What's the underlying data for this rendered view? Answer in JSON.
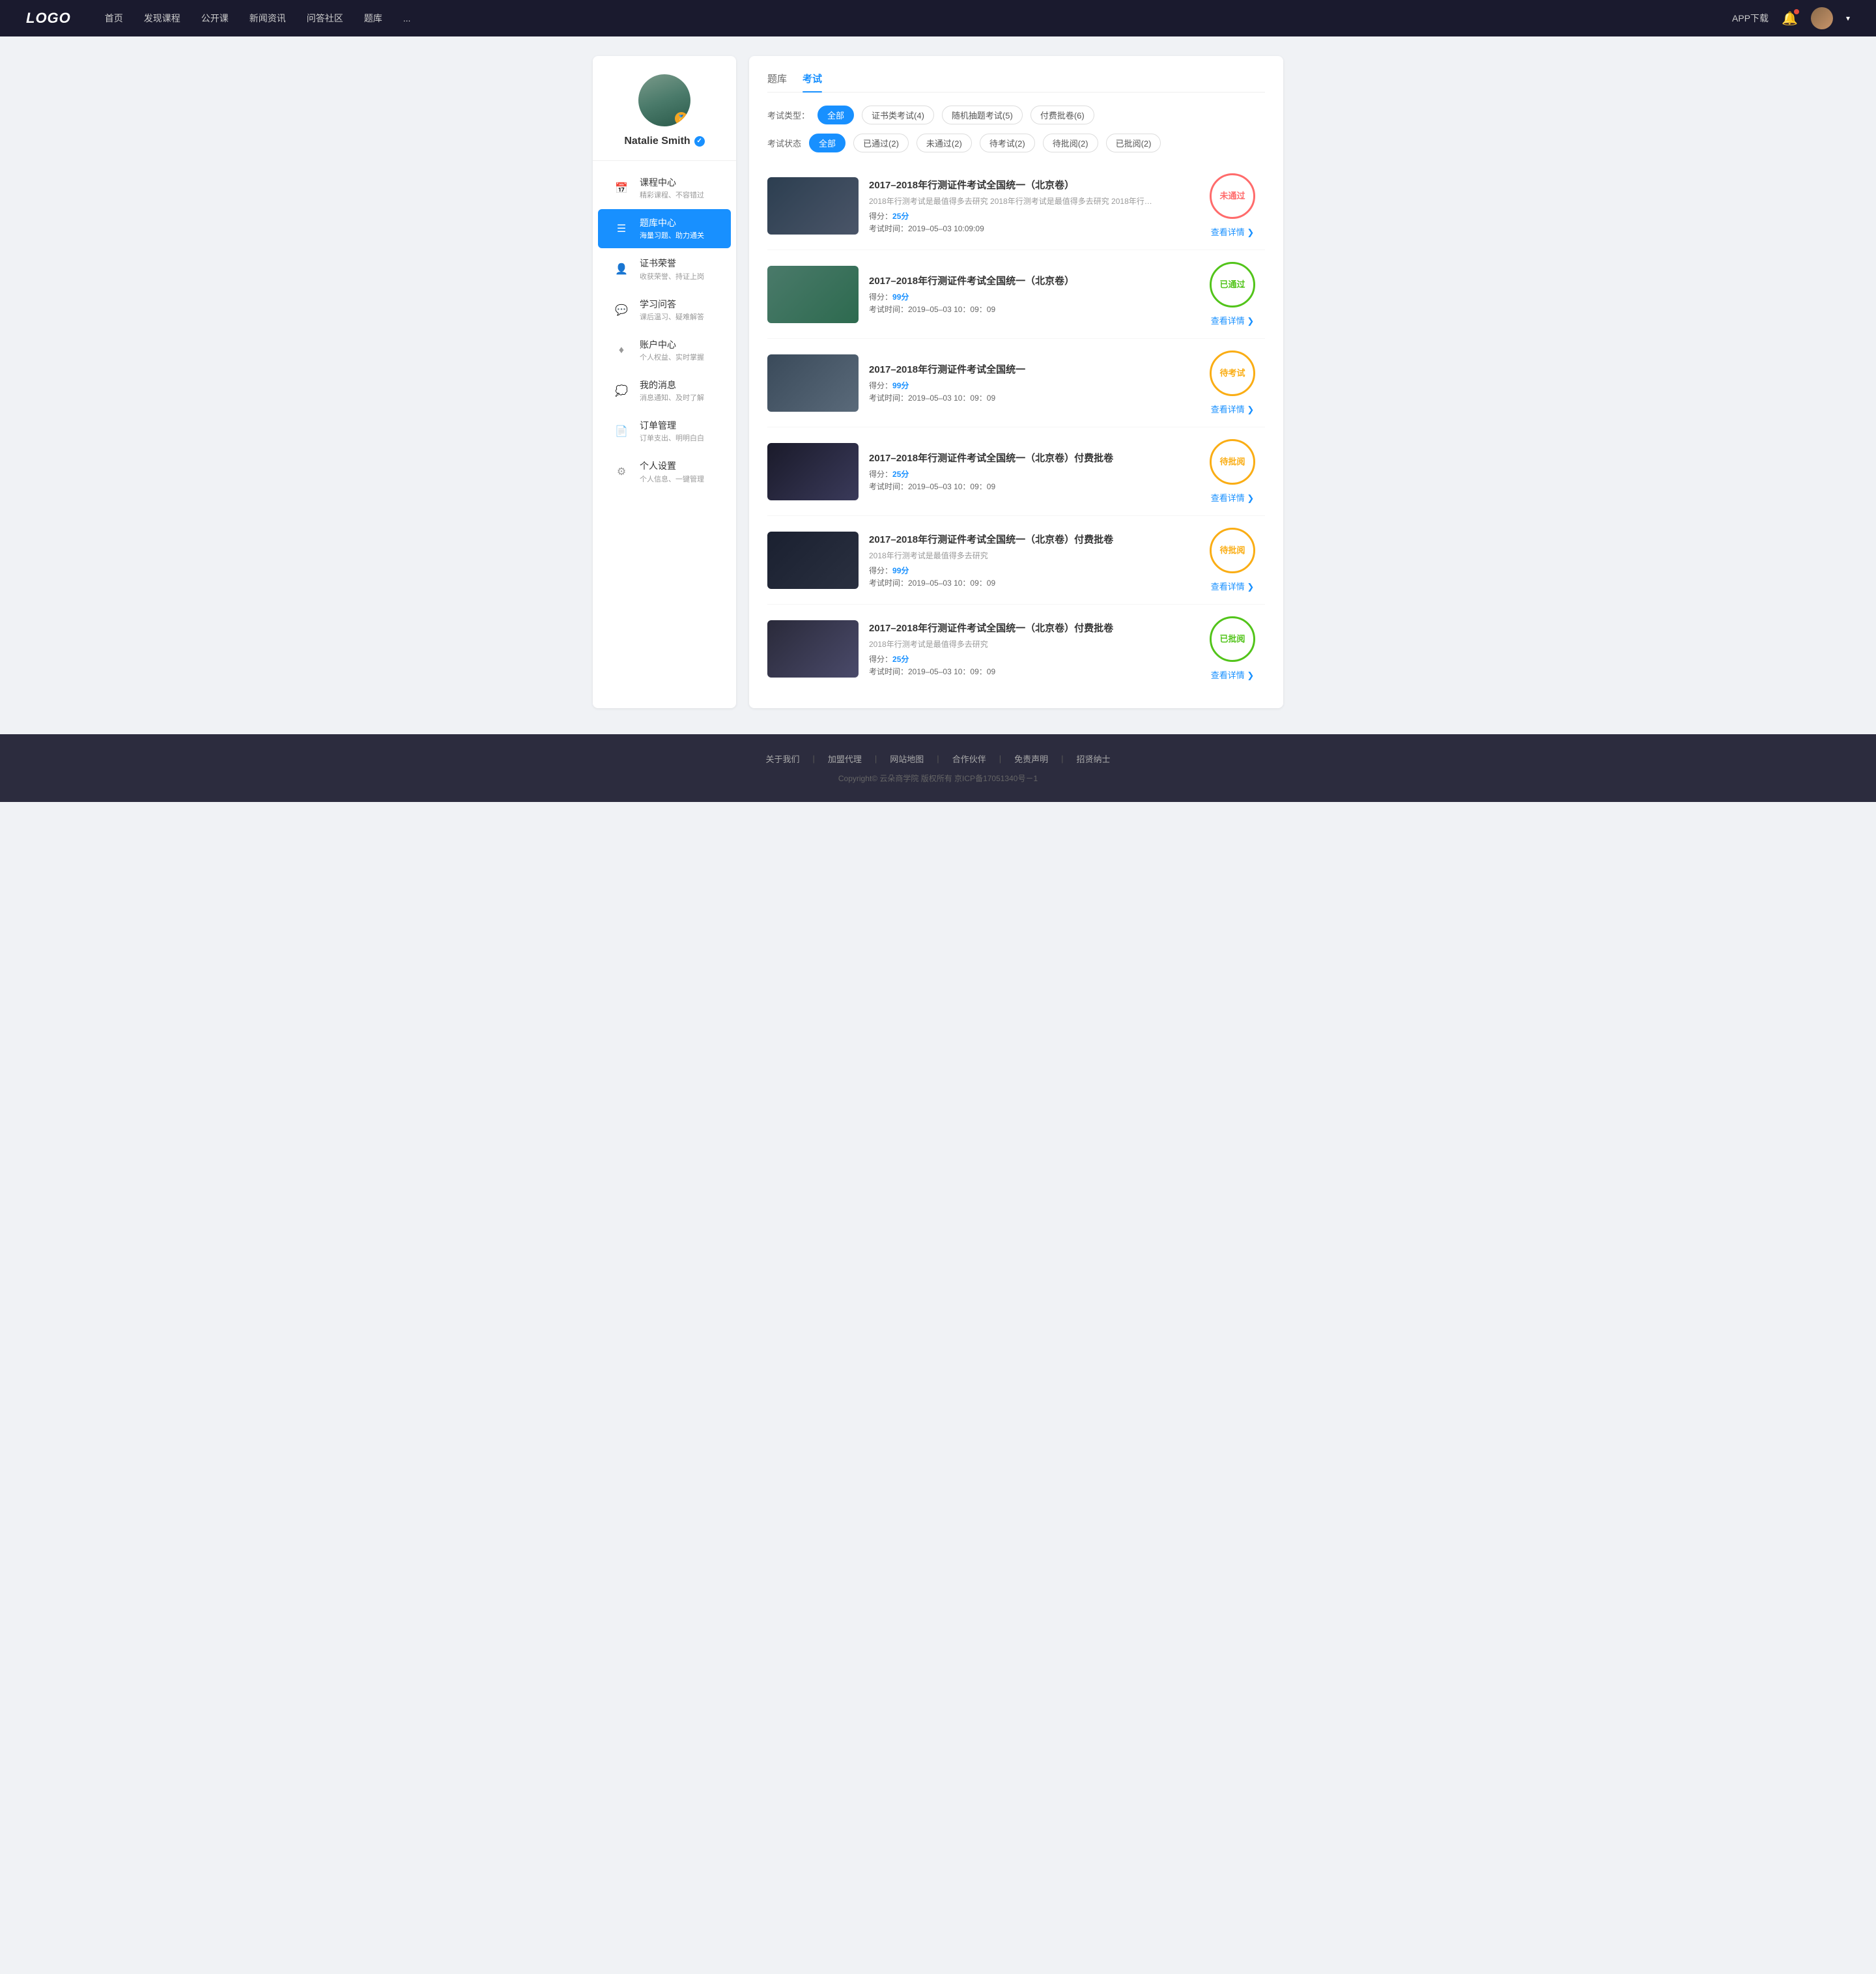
{
  "navbar": {
    "logo": "LOGO",
    "links": [
      "首页",
      "发现课程",
      "公开课",
      "新闻资讯",
      "问答社区",
      "题库",
      "..."
    ],
    "app_download": "APP下载",
    "user_menu_arrow": "▾"
  },
  "sidebar": {
    "username": "Natalie Smith",
    "verified_icon": "✓",
    "menu": [
      {
        "id": "course",
        "icon": "📅",
        "title": "课程中心",
        "subtitle": "精彩课程、不容错过"
      },
      {
        "id": "question-bank",
        "icon": "☰",
        "title": "题库中心",
        "subtitle": "海量习题、助力通关",
        "active": true
      },
      {
        "id": "certificate",
        "icon": "👤",
        "title": "证书荣誉",
        "subtitle": "收获荣誉、持证上岗"
      },
      {
        "id": "qa",
        "icon": "💬",
        "title": "学习问答",
        "subtitle": "课后温习、疑难解答"
      },
      {
        "id": "account",
        "icon": "♦",
        "title": "账户中心",
        "subtitle": "个人权益、实时掌握"
      },
      {
        "id": "messages",
        "icon": "💭",
        "title": "我的消息",
        "subtitle": "消息通知、及时了解"
      },
      {
        "id": "orders",
        "icon": "📄",
        "title": "订单管理",
        "subtitle": "订单支出、明明白白"
      },
      {
        "id": "settings",
        "icon": "⚙",
        "title": "个人设置",
        "subtitle": "个人信息、一键管理"
      }
    ]
  },
  "content": {
    "tabs": [
      {
        "id": "question-bank",
        "label": "题库"
      },
      {
        "id": "exam",
        "label": "考试",
        "active": true
      }
    ],
    "filter_type": {
      "label": "考试类型：",
      "options": [
        {
          "label": "全部",
          "active": true
        },
        {
          "label": "证书类考试(4)"
        },
        {
          "label": "随机抽题考试(5)"
        },
        {
          "label": "付费批卷(6)"
        }
      ]
    },
    "filter_status": {
      "label": "考试状态",
      "options": [
        {
          "label": "全部",
          "active": true
        },
        {
          "label": "已通过(2)"
        },
        {
          "label": "未通过(2)"
        },
        {
          "label": "待考试(2)"
        },
        {
          "label": "待批阅(2)"
        },
        {
          "label": "已批阅(2)"
        }
      ]
    },
    "exams": [
      {
        "title": "2017–2018年行测证件考试全国统一（北京卷）",
        "desc": "2018年行测考试是最值得多去研究 2018年行测考试是最值得多去研究 2018年行…",
        "score_label": "得分：",
        "score": "25分",
        "time_label": "考试时间：",
        "time": "2019–05–03  10:09:09",
        "stamp_text": "未通过",
        "stamp_type": "fail",
        "detail_label": "查看详情",
        "thumb_class": "thumb-1"
      },
      {
        "title": "2017–2018年行测证件考试全国统一（北京卷）",
        "desc": "",
        "score_label": "得分：",
        "score": "99分",
        "time_label": "考试时间：",
        "time": "2019–05–03  10：09：09",
        "stamp_text": "已通过",
        "stamp_type": "pass",
        "detail_label": "查看详情",
        "thumb_class": "thumb-2"
      },
      {
        "title": "2017–2018年行测证件考试全国统一",
        "desc": "",
        "score_label": "得分：",
        "score": "99分",
        "time_label": "考试时间：",
        "time": "2019–05–03  10：09：09",
        "stamp_text": "待考试",
        "stamp_type": "pending",
        "detail_label": "查看详情",
        "thumb_class": "thumb-3"
      },
      {
        "title": "2017–2018年行测证件考试全国统一（北京卷）付费批卷",
        "desc": "",
        "score_label": "得分：",
        "score": "25分",
        "time_label": "考试时间：",
        "time": "2019–05–03  10：09：09",
        "stamp_text": "待批阅",
        "stamp_type": "review",
        "detail_label": "查看详情",
        "thumb_class": "thumb-4"
      },
      {
        "title": "2017–2018年行测证件考试全国统一（北京卷）付费批卷",
        "desc": "2018年行测考试是最值得多去研究",
        "score_label": "得分：",
        "score": "99分",
        "time_label": "考试时间：",
        "time": "2019–05–03  10：09：09",
        "stamp_text": "待批阅",
        "stamp_type": "review",
        "detail_label": "查看详情",
        "thumb_class": "thumb-5"
      },
      {
        "title": "2017–2018年行测证件考试全国统一（北京卷）付费批卷",
        "desc": "2018年行测考试是最值得多去研究",
        "score_label": "得分：",
        "score": "25分",
        "time_label": "考试时间：",
        "time": "2019–05–03  10：09：09",
        "stamp_text": "已批阅",
        "stamp_type": "reviewed",
        "detail_label": "查看详情",
        "thumb_class": "thumb-6"
      }
    ]
  },
  "footer": {
    "links": [
      "关于我们",
      "加盟代理",
      "网站地图",
      "合作伙伴",
      "免责声明",
      "招贤纳士"
    ],
    "copyright": "Copyright© 云朵商学院  版权所有    京ICP备17051340号－1"
  }
}
